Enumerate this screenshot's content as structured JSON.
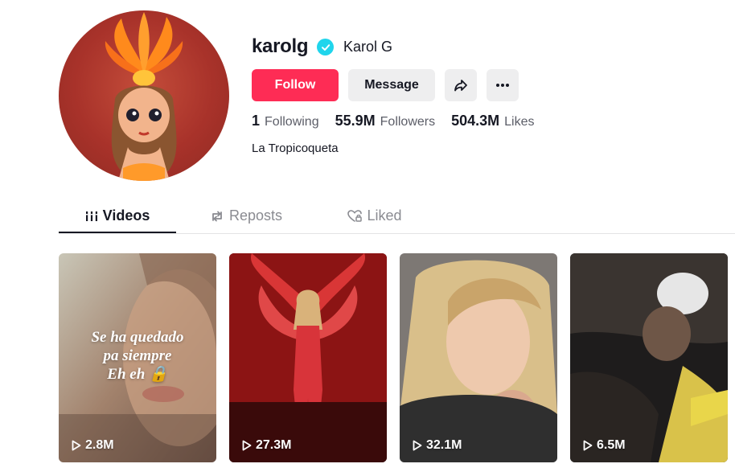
{
  "profile": {
    "username": "karolg",
    "display_name": "Karol G",
    "bio": "La Tropicoqueta",
    "verified": true
  },
  "actions": {
    "follow_label": "Follow",
    "message_label": "Message",
    "share_icon": "share-icon",
    "more_icon": "more-icon"
  },
  "stats": {
    "following_count": "1",
    "following_label": "Following",
    "followers_count": "55.9M",
    "followers_label": "Followers",
    "likes_count": "504.3M",
    "likes_label": "Likes"
  },
  "tabs": [
    {
      "label": "Videos",
      "icon": "grid-icon",
      "active": true
    },
    {
      "label": "Reposts",
      "icon": "repost-icon",
      "active": false
    },
    {
      "label": "Liked",
      "icon": "heart-lock-icon",
      "active": false
    }
  ],
  "videos": [
    {
      "views": "2.8M",
      "overlay_text": [
        "Se ha quedado",
        "pa siempre",
        "Eh eh 🔒"
      ]
    },
    {
      "views": "27.3M"
    },
    {
      "views": "32.1M"
    },
    {
      "views": "6.5M"
    }
  ],
  "colors": {
    "accent": "#fe2c55",
    "verified": "#20d5ec",
    "text_primary": "#161823",
    "text_secondary": "#5c5e68",
    "button_gray": "#eeeeef"
  }
}
